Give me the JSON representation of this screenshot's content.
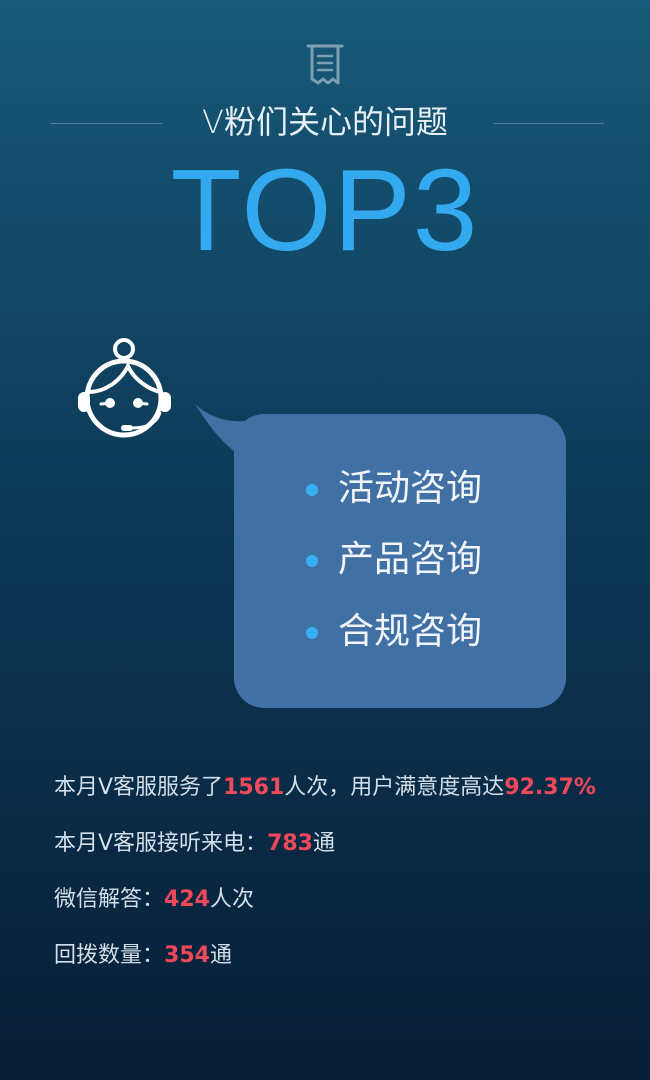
{
  "header": {
    "icon": "document-icon",
    "subtitle": "V粉们关心的问题",
    "title": "TOP3"
  },
  "agent": {
    "icon": "customer-service-agent-icon"
  },
  "bubble": {
    "items": [
      "活动咨询",
      "产品咨询",
      "合规咨询"
    ]
  },
  "stats": [
    {
      "prefix": "本月V客服服务了",
      "number": "1561",
      "middle": "人次，用户满意度高达",
      "number2": "92.37%"
    },
    {
      "prefix": "本月V客服接听来电：",
      "number": "783",
      "suffix": "通"
    },
    {
      "prefix": "微信解答：",
      "number": "424",
      "suffix": "人次"
    },
    {
      "prefix": "回拨数量：",
      "number": "354",
      "suffix": "通"
    }
  ],
  "colors": {
    "accent_blue": "#33aaf0",
    "highlight_red": "#f0495b",
    "bubble_blue": "#4070a4",
    "bg_top": "#175978",
    "bg_bottom": "#071e36"
  }
}
